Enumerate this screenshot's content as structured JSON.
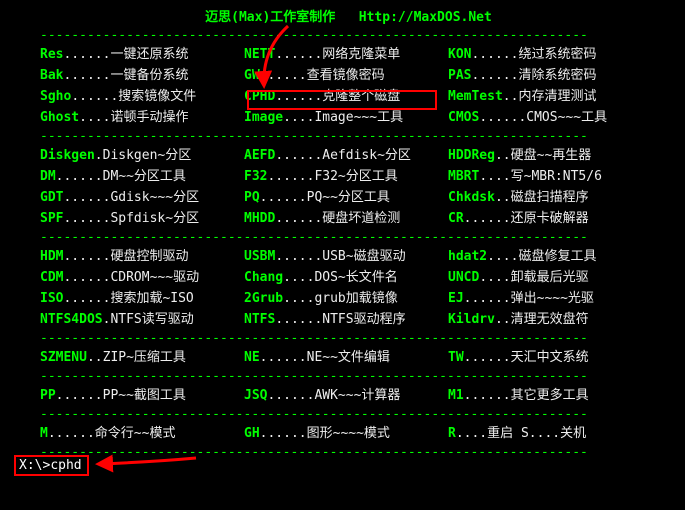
{
  "title_left": "迈思(Max)工作室制作",
  "title_right": "Http://MaxDOS.Net",
  "hr": "----------------------------------------------------------------------",
  "sections": [
    [
      [
        [
          "Res",
          "......",
          "一键还原系统"
        ],
        [
          "NETT",
          "......",
          "网络克隆菜单"
        ],
        [
          "KON",
          "......",
          "绕过系统密码"
        ]
      ],
      [
        [
          "Bak",
          "......",
          "一键备份系统"
        ],
        [
          "GW",
          "......",
          "查看镜像密码"
        ],
        [
          "PAS",
          "......",
          "清除系统密码"
        ]
      ],
      [
        [
          "Sgho",
          "......",
          "搜索镜像文件"
        ],
        [
          "CPHD",
          "......",
          "克隆整个磁盘"
        ],
        [
          "MemTest",
          "..",
          "内存清理测试"
        ]
      ],
      [
        [
          "Ghost",
          "....",
          "诺顿手动操作"
        ],
        [
          "Image",
          "....",
          "Image~~~工具"
        ],
        [
          "CMOS",
          "......",
          "CMOS~~~工具"
        ]
      ]
    ],
    [
      [
        [
          "Diskgen",
          ".",
          "Diskgen~分区"
        ],
        [
          "AEFD",
          "......",
          "Aefdisk~分区"
        ],
        [
          "HDDReg",
          "..",
          "硬盘~~再生器"
        ]
      ],
      [
        [
          "DM",
          "......",
          "DM~~分区工具"
        ],
        [
          "F32",
          "......",
          "F32~分区工具"
        ],
        [
          "MBRT",
          "....",
          "写~MBR:NT5/6"
        ]
      ],
      [
        [
          "GDT",
          "......",
          "Gdisk~~~分区"
        ],
        [
          "PQ",
          "......",
          "PQ~~分区工具"
        ],
        [
          "Chkdsk",
          "..",
          "磁盘扫描程序"
        ]
      ],
      [
        [
          "SPF",
          "......",
          "Spfdisk~分区"
        ],
        [
          "MHDD",
          "......",
          "硬盘坏道检测"
        ],
        [
          "CR",
          "......",
          "还原卡破解器"
        ]
      ]
    ],
    [
      [
        [
          "HDM",
          "......",
          "硬盘控制驱动"
        ],
        [
          "USBM",
          "......",
          "USB~磁盘驱动"
        ],
        [
          "hdat2",
          "....",
          "磁盘修复工具"
        ]
      ],
      [
        [
          "CDM",
          "......",
          "CDROM~~~驱动"
        ],
        [
          "Chang",
          "....",
          "DOS~长文件名"
        ],
        [
          "UNCD",
          "....",
          "卸载最后光驱"
        ]
      ],
      [
        [
          "ISO",
          "......",
          "搜索加载~ISO"
        ],
        [
          "2Grub",
          "....",
          "grub加载镜像"
        ],
        [
          "EJ",
          "......",
          "弹出~~~~光驱"
        ]
      ],
      [
        [
          "NTFS4DOS",
          ".",
          "NTFS读写驱动"
        ],
        [
          "NTFS",
          "......",
          "NTFS驱动程序"
        ],
        [
          "Kildrv",
          "..",
          "清理无效盘符"
        ]
      ]
    ],
    [
      [
        [
          "SZMENU",
          "..",
          "ZIP~压缩工具"
        ],
        [
          "NE",
          "......",
          "NE~~文件编辑"
        ],
        [
          "TW",
          "......",
          "天汇中文系统"
        ]
      ]
    ],
    [
      [
        [
          "PP",
          "......",
          "PP~~截图工具"
        ],
        [
          "JSQ",
          "......",
          "AWK~~~计算器"
        ],
        [
          "M1",
          "......",
          "其它更多工具"
        ]
      ]
    ],
    [
      [
        [
          "M",
          "......",
          "命令行~~模式"
        ],
        [
          "GH",
          "......",
          "图形~~~~模式"
        ],
        [
          "R",
          "....重启    S....",
          "关机"
        ]
      ]
    ]
  ],
  "prompt": {
    "path": "X:\\>",
    "cmd": "cphd"
  },
  "highlight": {
    "section": 0,
    "row": 2,
    "col": 1
  }
}
